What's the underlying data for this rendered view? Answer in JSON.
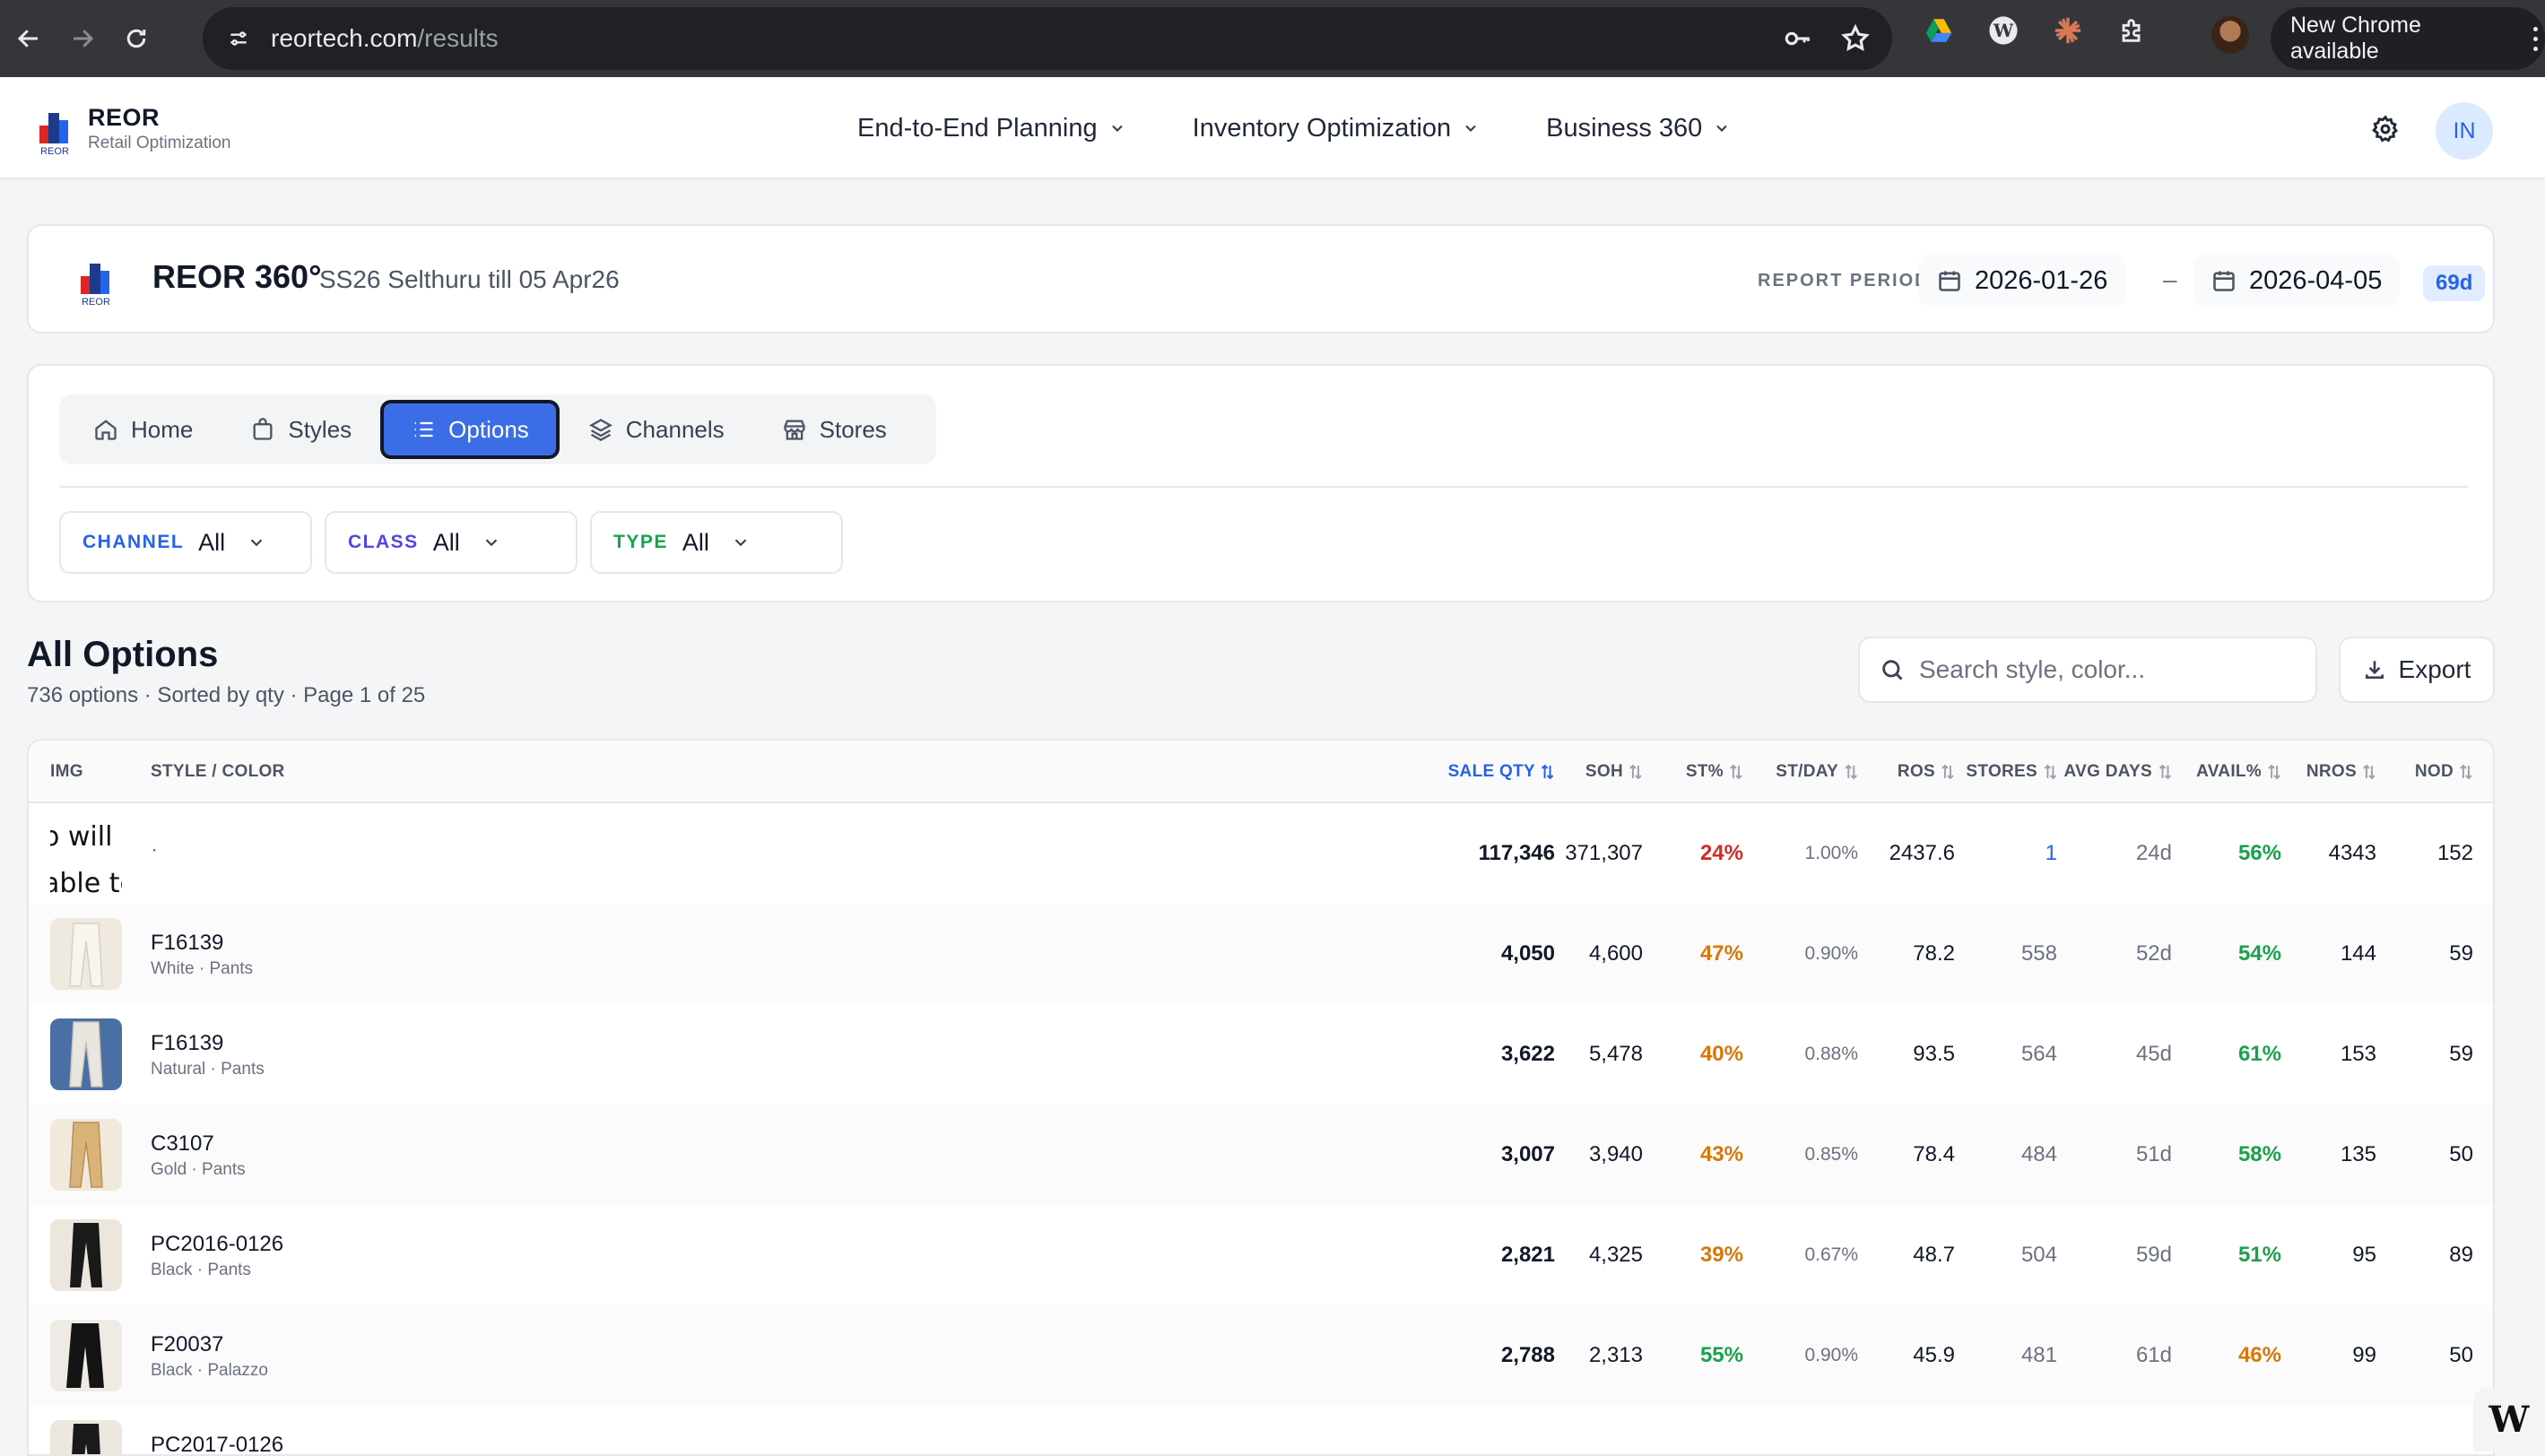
{
  "browser": {
    "url_host": "reortech.com",
    "url_path": "/results",
    "new_chrome_label": "New Chrome available"
  },
  "app": {
    "brand_name": "REOR",
    "brand_sub": "Retail Optimization",
    "logo_text": "REOR",
    "nav": [
      {
        "label": "End-to-End Planning"
      },
      {
        "label": "Inventory Optimization"
      },
      {
        "label": "Business 360"
      }
    ],
    "user_initials": "IN"
  },
  "report": {
    "title": "REOR 360°",
    "subtitle": "SS26 Selthuru till 05 Apr26",
    "period_label": "REPORT PERIOD",
    "start_date": "2026-01-26",
    "end_date": "2026-04-05",
    "dash": "–",
    "days": "69d"
  },
  "tabs": [
    {
      "label": "Home",
      "icon": "home-icon"
    },
    {
      "label": "Styles",
      "icon": "bag-icon"
    },
    {
      "label": "Options",
      "icon": "list-icon",
      "active": true
    },
    {
      "label": "Channels",
      "icon": "layers-icon"
    },
    {
      "label": "Stores",
      "icon": "store-icon"
    }
  ],
  "filters": [
    {
      "label": "CHANNEL",
      "value": "All",
      "color": "#2563eb"
    },
    {
      "label": "CLASS",
      "value": "All",
      "color": "#4f46e5"
    },
    {
      "label": "TYPE",
      "value": "All",
      "color": "#16a34a"
    }
  ],
  "options": {
    "title": "All Options",
    "meta": "736 options · Sorted by qty · Page 1 of 25",
    "search_placeholder": "Search style, color...",
    "export_label": "Export"
  },
  "table": {
    "columns": {
      "img": "IMG",
      "style": "STYLE / COLOR",
      "sale_qty": "SALE QTY",
      "soh": "SOH",
      "st": "ST%",
      "stday": "ST/DAY",
      "ros": "ROS",
      "stores": "STORES",
      "avg_days": "AVG DAYS",
      "avail": "AVAIL%",
      "nros": "NROS",
      "nod": "NOD"
    },
    "summary_row": {
      "broken_image_text_1": "o will r",
      "broken_image_text_2": "able to",
      "style": "·",
      "sale_qty": "117,346",
      "soh": "371,307",
      "st": "24%",
      "stday": "1.00%",
      "ros": "2437.6",
      "stores": "1",
      "avg_days": "24d",
      "avail": "56%",
      "nros": "4343",
      "nod": "152"
    },
    "rows": [
      {
        "style": "F16139",
        "sub": "White · Pants",
        "sale_qty": "4,050",
        "soh": "4,600",
        "st": "47%",
        "stday": "0.90%",
        "ros": "78.2",
        "stores": "558",
        "avg_days": "52d",
        "avail": "54%",
        "nros": "144",
        "nod": "59"
      },
      {
        "style": "F16139",
        "sub": "Natural · Pants",
        "sale_qty": "3,622",
        "soh": "5,478",
        "st": "40%",
        "stday": "0.88%",
        "ros": "93.5",
        "stores": "564",
        "avg_days": "45d",
        "avail": "61%",
        "nros": "153",
        "nod": "59"
      },
      {
        "style": "C3107",
        "sub": "Gold · Pants",
        "sale_qty": "3,007",
        "soh": "3,940",
        "st": "43%",
        "stday": "0.85%",
        "ros": "78.4",
        "stores": "484",
        "avg_days": "51d",
        "avail": "58%",
        "nros": "135",
        "nod": "50"
      },
      {
        "style": "PC2016-0126",
        "sub": "Black · Pants",
        "sale_qty": "2,821",
        "soh": "4,325",
        "st": "39%",
        "stday": "0.67%",
        "ros": "48.7",
        "stores": "504",
        "avg_days": "59d",
        "avail": "51%",
        "nros": "95",
        "nod": "89"
      },
      {
        "style": "F20037",
        "sub": "Black · Palazzo",
        "sale_qty": "2,788",
        "soh": "2,313",
        "st": "55%",
        "stday": "0.90%",
        "ros": "45.9",
        "stores": "481",
        "avg_days": "61d",
        "avail": "46%",
        "nros": "99",
        "nod": "50"
      },
      {
        "style": "PC2017-0126",
        "sub": "",
        "sale_qty": "",
        "soh": "",
        "st": "",
        "stday": "",
        "ros": "",
        "stores": "",
        "avg_days": "",
        "avail": "",
        "nros": "",
        "nod": ""
      }
    ]
  },
  "corner_widget_label": "W"
}
